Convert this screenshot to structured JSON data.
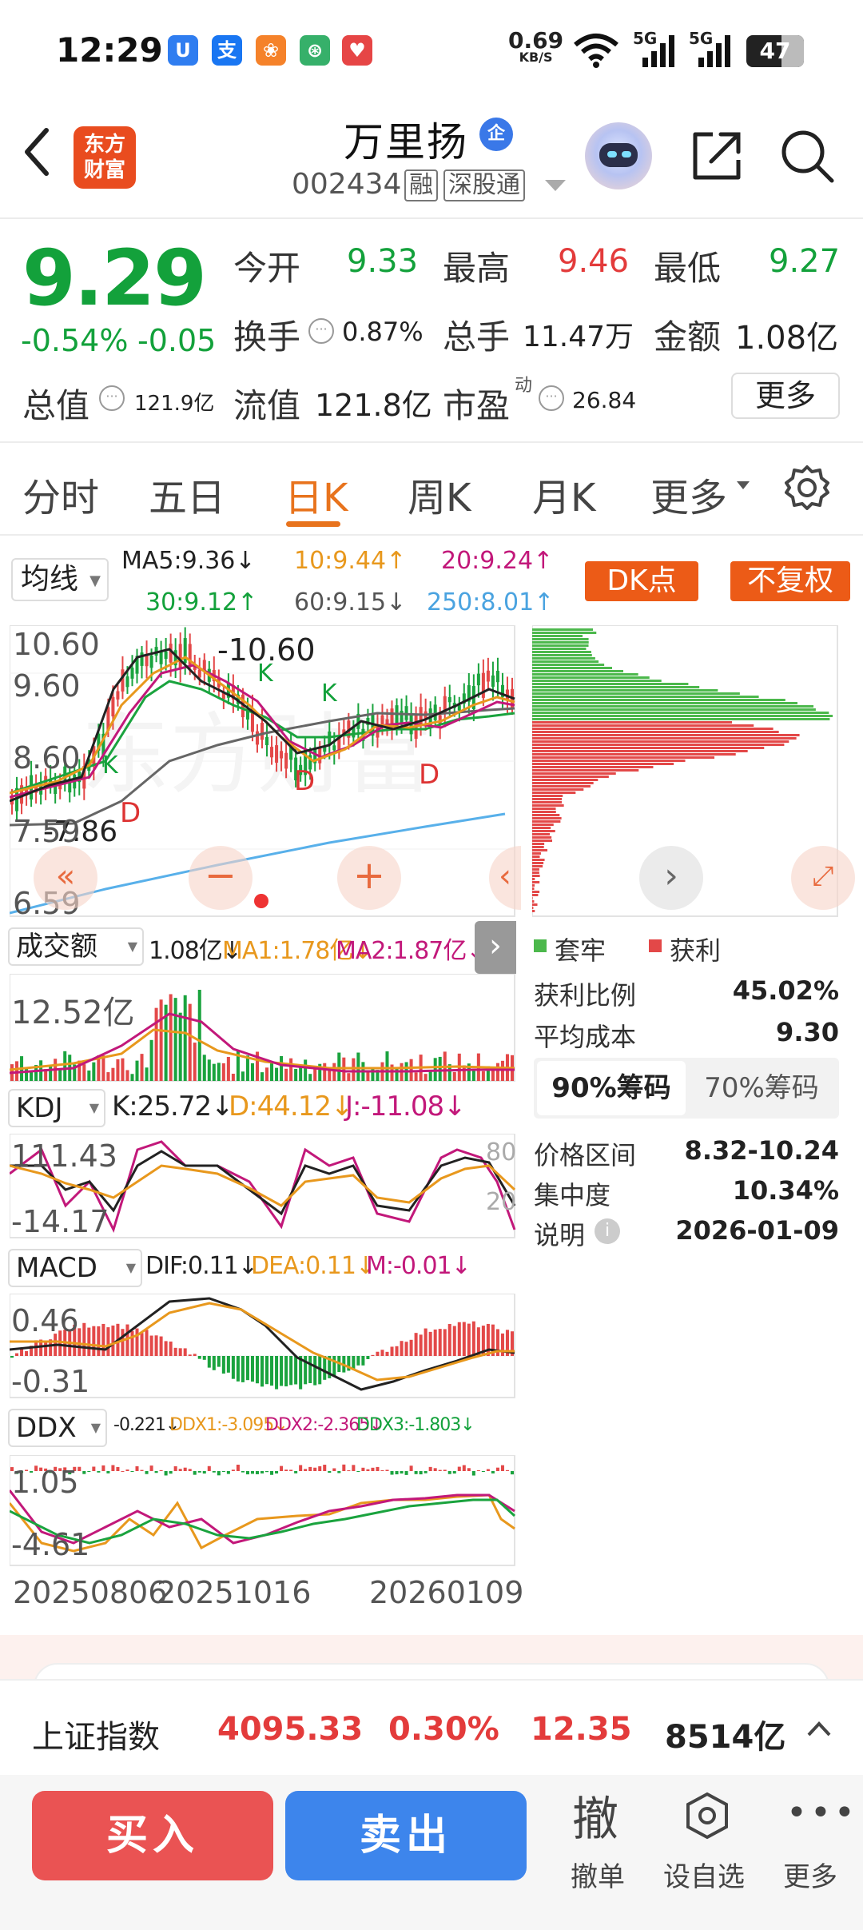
{
  "status_bar": {
    "time": "12:29",
    "speed_value": "0.69",
    "speed_unit": "KB/S",
    "net1": "5G",
    "net2": "5G",
    "battery": "47"
  },
  "header": {
    "logo_line1": "东方",
    "logo_line2": "财富",
    "stock_name": "万里扬",
    "badge": "企",
    "stock_code": "002434",
    "tags": [
      "融",
      "深股通"
    ]
  },
  "quote": {
    "price": "9.29",
    "change_pct": "-0.54%",
    "change_abs": "-0.05",
    "stats": [
      {
        "label": "今开",
        "value": "9.33"
      },
      {
        "label": "最高",
        "value": "9.46"
      },
      {
        "label": "最低",
        "value": "9.27"
      },
      {
        "label": "换手",
        "value": "0.87%"
      },
      {
        "label": "总手",
        "value": "11.47万"
      },
      {
        "label": "金额",
        "value": "1.08亿"
      },
      {
        "label": "总值",
        "value": "121.9亿"
      },
      {
        "label": "流值",
        "value": "121.8亿"
      },
      {
        "label": "市盈",
        "value": "26.84",
        "sup": "动"
      }
    ],
    "more_label": "更多"
  },
  "tabs": [
    {
      "label": "分时"
    },
    {
      "label": "五日"
    },
    {
      "label": "日K"
    },
    {
      "label": "周K"
    },
    {
      "label": "月K"
    },
    {
      "label": "更多"
    }
  ],
  "chart": {
    "ma_selector": "均线",
    "ma5": "MA5:9.36↓",
    "ma10": "10:9.44↑",
    "ma20": "20:9.24↑",
    "ma30": "30:9.12↑",
    "ma60": "60:9.15↓",
    "ma250": "250:8.01↑",
    "dk_button": "DK点",
    "fuquan_button": "不复权",
    "y_labels": [
      "10.60",
      "9.60",
      "8.60",
      "7.59",
      "6.59"
    ],
    "high_marker": "-10.60",
    "low_marker": "-7.86",
    "k_labels": [
      "K",
      "K",
      "K"
    ],
    "d_labels": [
      "D",
      "D",
      "D"
    ],
    "volume": {
      "selector": "成交额",
      "value": "1.08亿↓",
      "ma1": "MA1:1.78亿↓",
      "ma2": "MA2:1.87亿↓",
      "y_label": "12.52亿"
    },
    "kdj": {
      "selector": "KDJ",
      "k": "K:25.72↓",
      "d": "D:44.12↓",
      "j": "J:-11.08↓",
      "y_top": "111.43",
      "y_bottom": "-14.17",
      "r_top": "80",
      "r_bottom": "20"
    },
    "macd": {
      "selector": "MACD",
      "dif": "DIF:0.11↓",
      "dea": "DEA:0.11↓",
      "m": "M:-0.01↓",
      "y_top": "0.46",
      "y_bottom": "-0.31"
    },
    "ddx": {
      "selector": "DDX",
      "ddx": "-0.221↓",
      "ddx1": "DDX1:-3.095↓",
      "ddx2": "DDX2:-2.365↓",
      "ddx3": "DDX3:-1.803↓",
      "y_top": "1.05",
      "y_bottom": "-4.61"
    },
    "dates": [
      "20250806",
      "20251016",
      "20260109"
    ]
  },
  "chip_panel": {
    "legend_trapped": "套牢",
    "legend_profit": "获利",
    "rows_top": [
      {
        "label": "获利比例",
        "value": "45.02%"
      },
      {
        "label": "平均成本",
        "value": "9.30"
      }
    ],
    "seg_a": "90%筹码",
    "seg_b": "70%筹码",
    "rows_bottom": [
      {
        "label": "价格区间",
        "value": "8.32-10.24"
      },
      {
        "label": "集中度",
        "value": "10.34%"
      },
      {
        "label": "说明",
        "value": "2026-01-09"
      }
    ]
  },
  "ticker": {
    "name": "上证指数",
    "price": "4095.33",
    "pct": "0.30%",
    "change": "12.35",
    "amount": "8514亿"
  },
  "actions": {
    "buy": "买入",
    "sell": "卖出",
    "cancel_glyph": "撤",
    "cancel": "撤单",
    "watchlist": "设自选",
    "more": "更多"
  },
  "colors": {
    "up": "#e33b3b",
    "down": "#13a13b",
    "accent": "#e8731d",
    "buy": "#ea5353",
    "sell": "#3d85ec"
  }
}
